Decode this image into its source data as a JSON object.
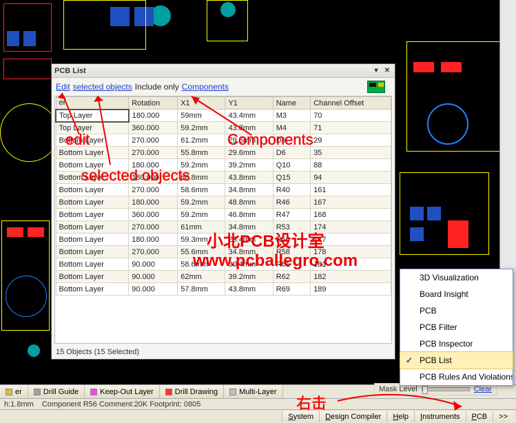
{
  "panel": {
    "title": "PCB List",
    "filter": {
      "edit": "Edit",
      "sel": "selected objects",
      "mid": "Include only",
      "comp": "Components"
    },
    "columns": [
      "er",
      "Rotation",
      "X1",
      "Y1",
      "Name",
      "Channel Offset"
    ],
    "rows": [
      {
        "layer": "Top Layer",
        "rot": "180.000",
        "x1": "59mm",
        "y1": "43.4mm",
        "name": "M3",
        "ch": "70"
      },
      {
        "layer": "Top Layer",
        "rot": "360.000",
        "x1": "59.2mm",
        "y1": "43.8mm",
        "name": "M4",
        "ch": "71"
      },
      {
        "layer": "Bottom Layer",
        "rot": "270.000",
        "x1": "61.2mm",
        "y1": "29.6mm",
        "name": "D5",
        "ch": "29"
      },
      {
        "layer": "Bottom Layer",
        "rot": "270.000",
        "x1": "55.8mm",
        "y1": "29.6mm",
        "name": "D6",
        "ch": "35"
      },
      {
        "layer": "Bottom Layer",
        "rot": "180.000",
        "x1": "59.2mm",
        "y1": "39.2mm",
        "name": "Q10",
        "ch": "88"
      },
      {
        "layer": "Bottom Layer",
        "rot": "180.000",
        "x1": "60.8mm",
        "y1": "43.8mm",
        "name": "Q15",
        "ch": "94"
      },
      {
        "layer": "Bottom Layer",
        "rot": "270.000",
        "x1": "58.6mm",
        "y1": "34.8mm",
        "name": "R40",
        "ch": "161"
      },
      {
        "layer": "Bottom Layer",
        "rot": "180.000",
        "x1": "59.2mm",
        "y1": "48.8mm",
        "name": "R46",
        "ch": "167"
      },
      {
        "layer": "Bottom Layer",
        "rot": "360.000",
        "x1": "59.2mm",
        "y1": "46.8mm",
        "name": "R47",
        "ch": "168"
      },
      {
        "layer": "Bottom Layer",
        "rot": "270.000",
        "x1": "61mm",
        "y1": "34.8mm",
        "name": "R53",
        "ch": "174"
      },
      {
        "layer": "Bottom Layer",
        "rot": "180.000",
        "x1": "59.3mm",
        "y1": "25.4mm",
        "name": "R56",
        "ch": "177"
      },
      {
        "layer": "Bottom Layer",
        "rot": "270.000",
        "x1": "55.6mm",
        "y1": "34.8mm",
        "name": "R58",
        "ch": "178"
      },
      {
        "layer": "Bottom Layer",
        "rot": "90.000",
        "x1": "58.6mm",
        "y1": "30.4mm",
        "name": "R61",
        "ch": "181"
      },
      {
        "layer": "Bottom Layer",
        "rot": "90.000",
        "x1": "62mm",
        "y1": "39.2mm",
        "name": "R62",
        "ch": "182"
      },
      {
        "layer": "Bottom Layer",
        "rot": "90.000",
        "x1": "57.8mm",
        "y1": "43.8mm",
        "name": "R69",
        "ch": "189"
      }
    ],
    "status": "15 Objects (15 Selected)"
  },
  "tabs": [
    {
      "color": "#d0c040",
      "label": "er"
    },
    {
      "color": "#a0a0a0",
      "label": "Drill Guide"
    },
    {
      "color": "#ff40ff",
      "label": "Keep-Out Layer"
    },
    {
      "color": "#ff3030",
      "label": "Drill Drawing"
    },
    {
      "color": "#c0c0c0",
      "label": "Multi-Layer"
    }
  ],
  "status": {
    "a": "h:1.8mm",
    "b": "Component R56 Comment:20K Footprint: 0805"
  },
  "mask": {
    "label": "Mask Level",
    "clear": "Clear"
  },
  "bottom": [
    {
      "u": "S",
      "t": "ystem"
    },
    {
      "u": "D",
      "t": "esign Compiler"
    },
    {
      "u": "H",
      "t": "elp"
    },
    {
      "u": "I",
      "t": "nstruments"
    },
    {
      "u": "P",
      "t": "CB"
    },
    {
      "u": "",
      "t": ">>"
    }
  ],
  "ctx": {
    "items": [
      "3D Visualization",
      "Board Insight",
      "PCB",
      "PCB Filter",
      "PCB Inspector",
      "PCB List",
      "PCB Rules And Violations"
    ],
    "selected": 5
  },
  "annot": {
    "edit": "edit",
    "sel": "selected objects",
    "comp": "Components",
    "rclick": "右击",
    "wm1": "小北PCB设计室",
    "wm2": "www.pcballegro.com"
  }
}
